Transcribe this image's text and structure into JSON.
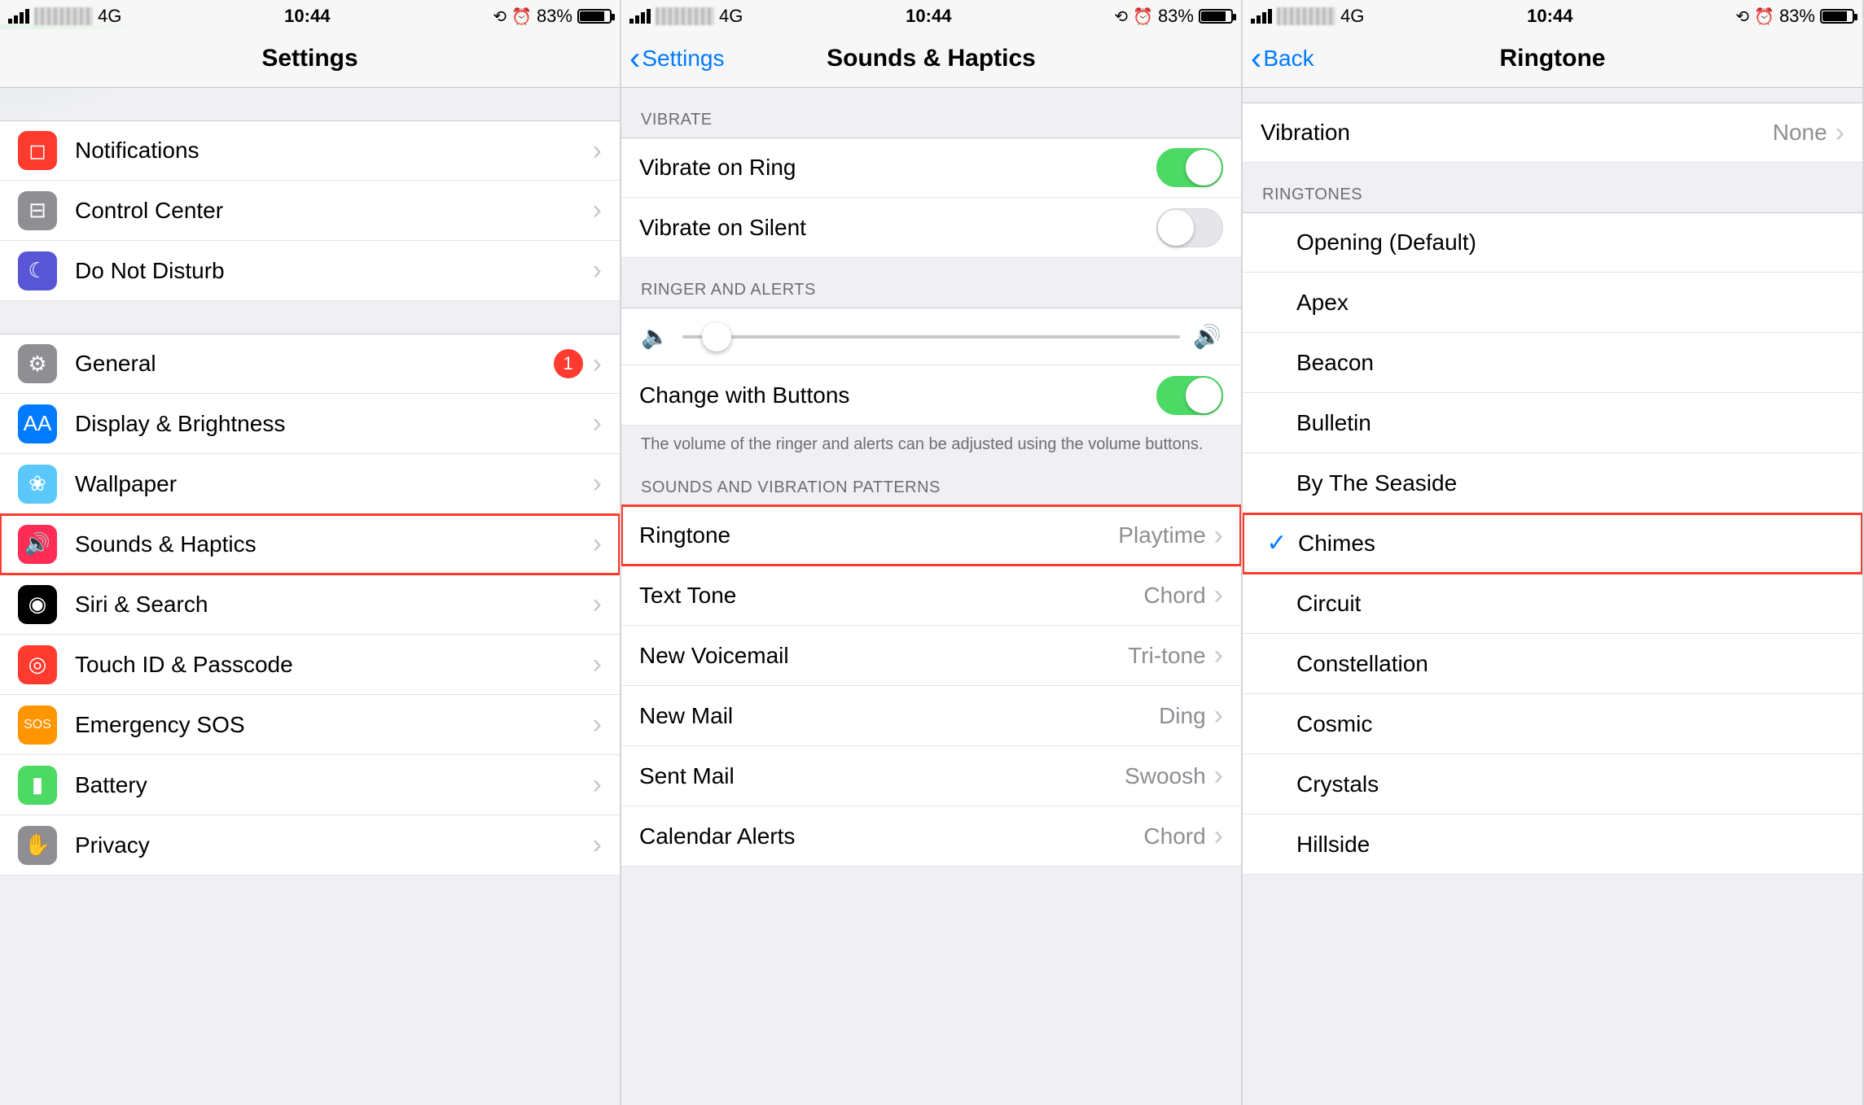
{
  "status": {
    "network": "4G",
    "time": "10:44",
    "battery_pct": "83%"
  },
  "phone1": {
    "title": "Settings",
    "group1": [
      {
        "label": "Notifications",
        "color": "ic-red",
        "glyph": "◻"
      },
      {
        "label": "Control Center",
        "color": "ic-gray",
        "glyph": "⊟"
      },
      {
        "label": "Do Not Disturb",
        "color": "ic-purple",
        "glyph": "☾"
      }
    ],
    "group2": [
      {
        "label": "General",
        "color": "ic-gray",
        "glyph": "⚙",
        "badge": "1"
      },
      {
        "label": "Display & Brightness",
        "color": "ic-blue",
        "glyph": "AA"
      },
      {
        "label": "Wallpaper",
        "color": "ic-cyan",
        "glyph": "❀"
      },
      {
        "label": "Sounds & Haptics",
        "color": "ic-pink",
        "glyph": "🔊",
        "highlight": true
      },
      {
        "label": "Siri & Search",
        "color": "ic-black",
        "glyph": "◉"
      },
      {
        "label": "Touch ID & Passcode",
        "color": "ic-red",
        "glyph": "◎"
      },
      {
        "label": "Emergency SOS",
        "color": "ic-orange",
        "glyph": "SOS"
      },
      {
        "label": "Battery",
        "color": "ic-green",
        "glyph": "▮"
      },
      {
        "label": "Privacy",
        "color": "ic-gray",
        "glyph": "✋"
      }
    ]
  },
  "phone2": {
    "back": "Settings",
    "title": "Sounds & Haptics",
    "sec_vibrate": "VIBRATE",
    "vibrate_ring": "Vibrate on Ring",
    "vibrate_silent": "Vibrate on Silent",
    "sec_ringer": "RINGER AND ALERTS",
    "change_buttons": "Change with Buttons",
    "footer": "The volume of the ringer and alerts can be adjusted using the volume buttons.",
    "sec_sounds": "SOUNDS AND VIBRATION PATTERNS",
    "rows": [
      {
        "label": "Ringtone",
        "value": "Playtime",
        "highlight": true
      },
      {
        "label": "Text Tone",
        "value": "Chord"
      },
      {
        "label": "New Voicemail",
        "value": "Tri-tone"
      },
      {
        "label": "New Mail",
        "value": "Ding"
      },
      {
        "label": "Sent Mail",
        "value": "Swoosh"
      },
      {
        "label": "Calendar Alerts",
        "value": "Chord"
      }
    ]
  },
  "phone3": {
    "back": "Back",
    "title": "Ringtone",
    "vibration_label": "Vibration",
    "vibration_value": "None",
    "sec": "RINGTONES",
    "tones": [
      {
        "label": "Opening (Default)"
      },
      {
        "label": "Apex"
      },
      {
        "label": "Beacon"
      },
      {
        "label": "Bulletin"
      },
      {
        "label": "By The Seaside"
      },
      {
        "label": "Chimes",
        "checked": true,
        "highlight": true
      },
      {
        "label": "Circuit"
      },
      {
        "label": "Constellation"
      },
      {
        "label": "Cosmic"
      },
      {
        "label": "Crystals"
      },
      {
        "label": "Hillside"
      }
    ]
  }
}
